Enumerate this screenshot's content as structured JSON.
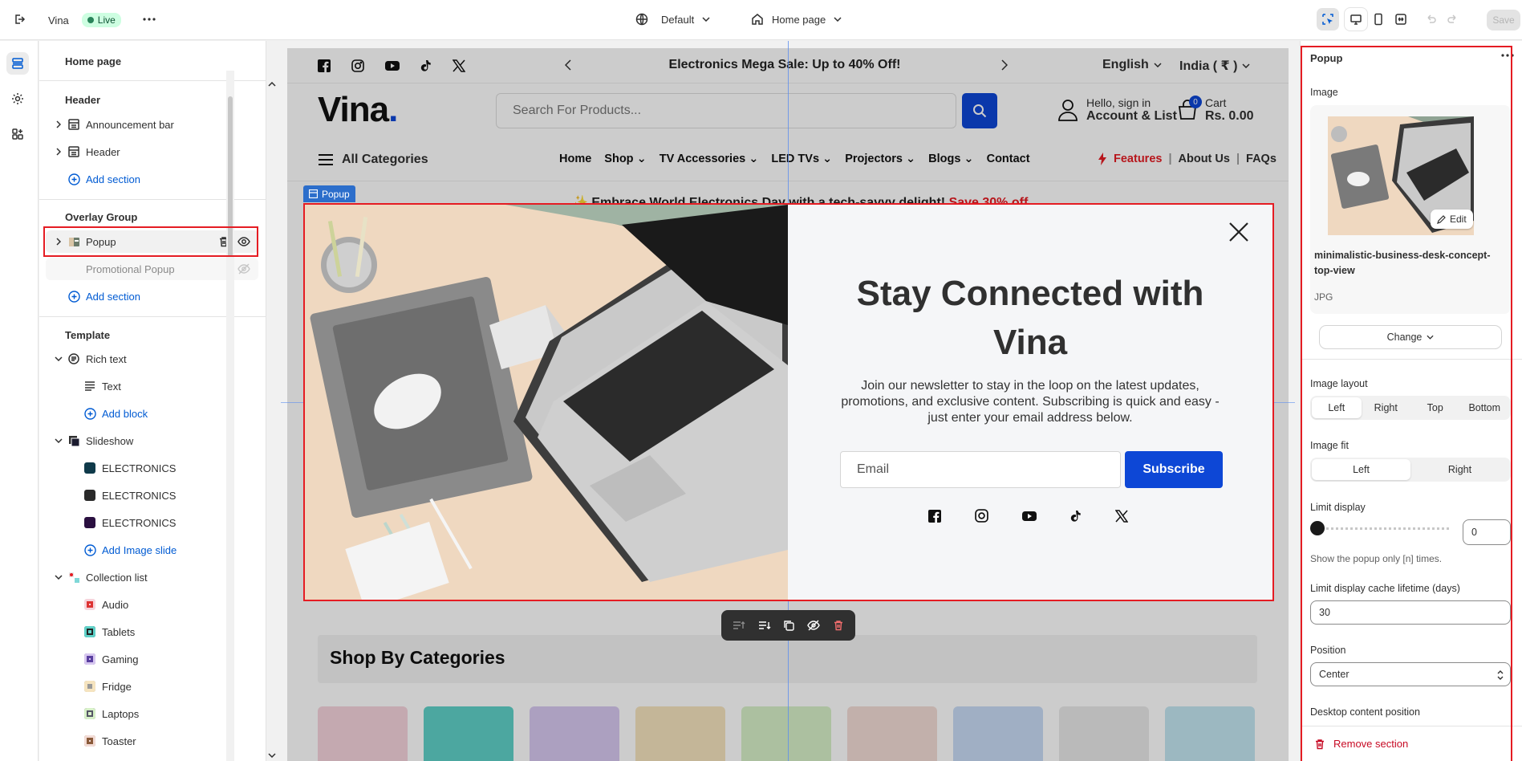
{
  "topbar": {
    "store_name": "Vina",
    "live_label": "Live",
    "theme_label": "Default",
    "page_label": "Home page",
    "save_label": "Save"
  },
  "sidebar": {
    "title": "Home page",
    "header_group": "Header",
    "header_items": [
      "Announcement bar",
      "Header"
    ],
    "add_section": "Add section",
    "overlay_group": "Overlay Group",
    "overlay_items": [
      "Popup",
      "Promotional Popup"
    ],
    "template_group": "Template",
    "rich_text": "Rich text",
    "text_block": "Text",
    "add_block": "Add block",
    "slideshow": "Slideshow",
    "slides": [
      "ELECTRONICS",
      "ELECTRONICS",
      "ELECTRONICS"
    ],
    "add_image_slide": "Add Image slide",
    "collection_list": "Collection list",
    "collections": [
      "Audio",
      "Tablets",
      "Gaming",
      "Fridge",
      "Laptops",
      "Toaster"
    ]
  },
  "store": {
    "announcement": "Electronics Mega Sale: Up to 40% Off!",
    "language": "English",
    "currency": "India ( ₹ )",
    "logo": "Vina",
    "logo_dot": ".",
    "search_placeholder": "Search For Products...",
    "account_line1": "Hello, sign in",
    "account_line2": "Account & List",
    "cart_count": "0",
    "cart_label": "Cart",
    "cart_total": "Rs. 0.00",
    "all_categories": "All Categories",
    "nav": [
      "Home",
      "Shop",
      "TV Accessories",
      "LED TVs",
      "Projectors",
      "Blogs",
      "Contact"
    ],
    "features": "Features",
    "about": "About Us",
    "faqs": "FAQs",
    "banner_text": "Embrace World Electronics Day with a tech-savvy delight!",
    "banner_sale": "Save 30% off",
    "popup_tag": "Popup",
    "shop_by_categories": "Shop By Categories"
  },
  "popup": {
    "heading": "Stay Connected with Vina",
    "body": "Join our newsletter to stay in the loop on the latest updates, promotions, and exclusive content. Subscribing is quick and easy - just enter your email address below.",
    "email_placeholder": "Email",
    "subscribe_label": "Subscribe"
  },
  "panel": {
    "title": "Popup",
    "image_label": "Image",
    "edit_label": "Edit",
    "file_name": "minimalistic-business-desk-concept-top-view",
    "file_type": "JPG",
    "change_label": "Change",
    "image_layout_label": "Image layout",
    "image_layout_options": [
      "Left",
      "Right",
      "Top",
      "Bottom"
    ],
    "image_layout_selected": "Left",
    "image_fit_label": "Image fit",
    "image_fit_options": [
      "Left",
      "Right"
    ],
    "image_fit_selected": "Left",
    "limit_display_label": "Limit display",
    "limit_display_value": "0",
    "limit_display_help": "Show the popup only [n] times.",
    "cache_label": "Limit display cache lifetime (days)",
    "cache_value": "30",
    "position_label": "Position",
    "position_value": "Center",
    "desktop_position_label": "Desktop content position",
    "remove_section": "Remove section"
  },
  "colors": {
    "accent_blue": "#005bd3",
    "store_blue": "#0d47d6",
    "highlight_red": "#e51c23",
    "live_green": "#29845a"
  }
}
